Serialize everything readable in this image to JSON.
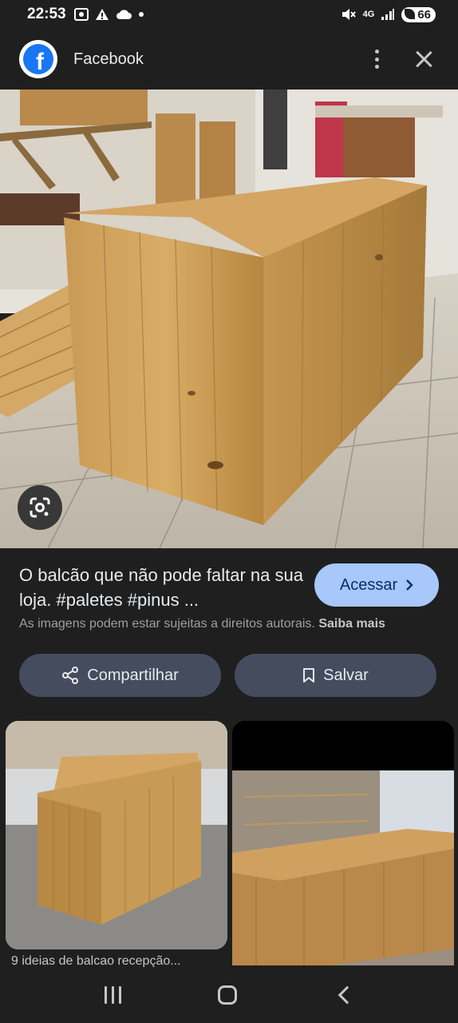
{
  "status_bar": {
    "time": "22:53",
    "battery": "66",
    "network": "4G",
    "left_icons": [
      "screenshot-icon",
      "cloud-icon",
      "warning-icon",
      "dot-icon"
    ],
    "right_icons": [
      "mute-icon",
      "network-4g-icon",
      "signal-icon",
      "battery-saver-icon"
    ]
  },
  "app_bar": {
    "source_name": "Facebook",
    "logo_letter": "f",
    "more_icon": "more-vert-icon",
    "close_icon": "close-icon"
  },
  "result": {
    "caption": "O balcão que não pode faltar na sua loja. #paletes #pinus ...",
    "visit_label": "Acessar",
    "copyright_text": "As imagens podem estar sujeitas a direitos autorais.",
    "learn_more": "Saiba mais",
    "share_label": "Compartilhar",
    "save_label": "Salvar"
  },
  "related": [
    {
      "caption": "9 ideias de balcao recepção..."
    },
    {
      "caption": ""
    }
  ],
  "colors": {
    "background": "#1f1f1f",
    "visit_button": "#a8c7fa",
    "pill_button": "#444c5e",
    "facebook_blue": "#1877f2"
  }
}
